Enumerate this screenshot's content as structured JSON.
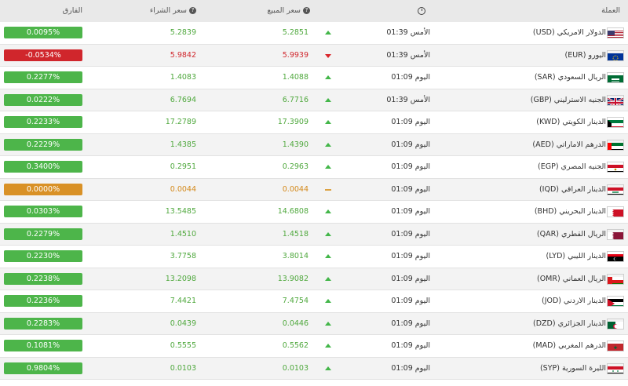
{
  "header": {
    "currency": "العملة",
    "sell": "سعر المبيع",
    "buy": "سعر الشراء",
    "diff": "الفارق",
    "clock_icon": "clock-icon",
    "help_icon": "help-icon"
  },
  "rows": [
    {
      "currency": "الدولار الامريكي (USD)",
      "flag": "usa",
      "time": "الأمس 01:39",
      "trend": "up",
      "sell": "5.2851",
      "buy": "5.2839",
      "diff": "0.0095%"
    },
    {
      "currency": "اليورو (EUR)",
      "flag": "eu",
      "time": "الأمس 01:39",
      "trend": "down",
      "sell": "5.9939",
      "buy": "5.9842",
      "diff": "-0.0534%"
    },
    {
      "currency": "الريال السعودي (SAR)",
      "flag": "sa",
      "time": "اليوم 01:09",
      "trend": "up",
      "sell": "1.4088",
      "buy": "1.4083",
      "diff": "0.2277%"
    },
    {
      "currency": "الجنيه الاسترليني (GBP)",
      "flag": "gb",
      "time": "الأمس 01:39",
      "trend": "up",
      "sell": "6.7716",
      "buy": "6.7694",
      "diff": "0.0222%"
    },
    {
      "currency": "الدينار الكويتي (KWD)",
      "flag": "kw",
      "time": "اليوم 01:09",
      "trend": "up",
      "sell": "17.3909",
      "buy": "17.2789",
      "diff": "0.2233%"
    },
    {
      "currency": "الدرهم الاماراتي (AED)",
      "flag": "ae",
      "time": "اليوم 01:09",
      "trend": "up",
      "sell": "1.4390",
      "buy": "1.4385",
      "diff": "0.2229%"
    },
    {
      "currency": "الجنيه المصري (EGP)",
      "flag": "eg",
      "time": "اليوم 01:09",
      "trend": "up",
      "sell": "0.2963",
      "buy": "0.2951",
      "diff": "0.3400%"
    },
    {
      "currency": "الدينار العراقي (IQD)",
      "flag": "iq",
      "time": "اليوم 01:09",
      "trend": "flat",
      "sell": "0.0044",
      "buy": "0.0044",
      "diff": "0.0000%"
    },
    {
      "currency": "الدينار البحريني (BHD)",
      "flag": "bh",
      "time": "اليوم 01:09",
      "trend": "up",
      "sell": "14.6808",
      "buy": "13.5485",
      "diff": "0.0303%"
    },
    {
      "currency": "الريال القطري (QAR)",
      "flag": "qa",
      "time": "اليوم 01:09",
      "trend": "up",
      "sell": "1.4518",
      "buy": "1.4510",
      "diff": "0.2279%"
    },
    {
      "currency": "الدينار الليبي (LYD)",
      "flag": "ly",
      "time": "اليوم 01:09",
      "trend": "up",
      "sell": "3.8014",
      "buy": "3.7758",
      "diff": "0.2230%"
    },
    {
      "currency": "الريال العماني (OMR)",
      "flag": "om",
      "time": "اليوم 01:09",
      "trend": "up",
      "sell": "13.9082",
      "buy": "13.2098",
      "diff": "0.2238%"
    },
    {
      "currency": "الدينار الاردني (JOD)",
      "flag": "jo",
      "time": "اليوم 01:09",
      "trend": "up",
      "sell": "7.4754",
      "buy": "7.4421",
      "diff": "0.2236%"
    },
    {
      "currency": "الدينار الجزائري (DZD)",
      "flag": "dz",
      "time": "اليوم 01:09",
      "trend": "up",
      "sell": "0.0446",
      "buy": "0.0439",
      "diff": "0.2283%"
    },
    {
      "currency": "الدرهم المغربي (MAD)",
      "flag": "ma",
      "time": "اليوم 01:09",
      "trend": "up",
      "sell": "0.5562",
      "buy": "0.5555",
      "diff": "0.1081%"
    },
    {
      "currency": "الليرة السورية (SYP)",
      "flag": "sy",
      "time": "اليوم 01:09",
      "trend": "up",
      "sell": "0.0103",
      "buy": "0.0103",
      "diff": "0.9804%"
    }
  ],
  "colors": {
    "up": "#4db54a",
    "down": "#d0262c",
    "flat": "#d99126"
  }
}
